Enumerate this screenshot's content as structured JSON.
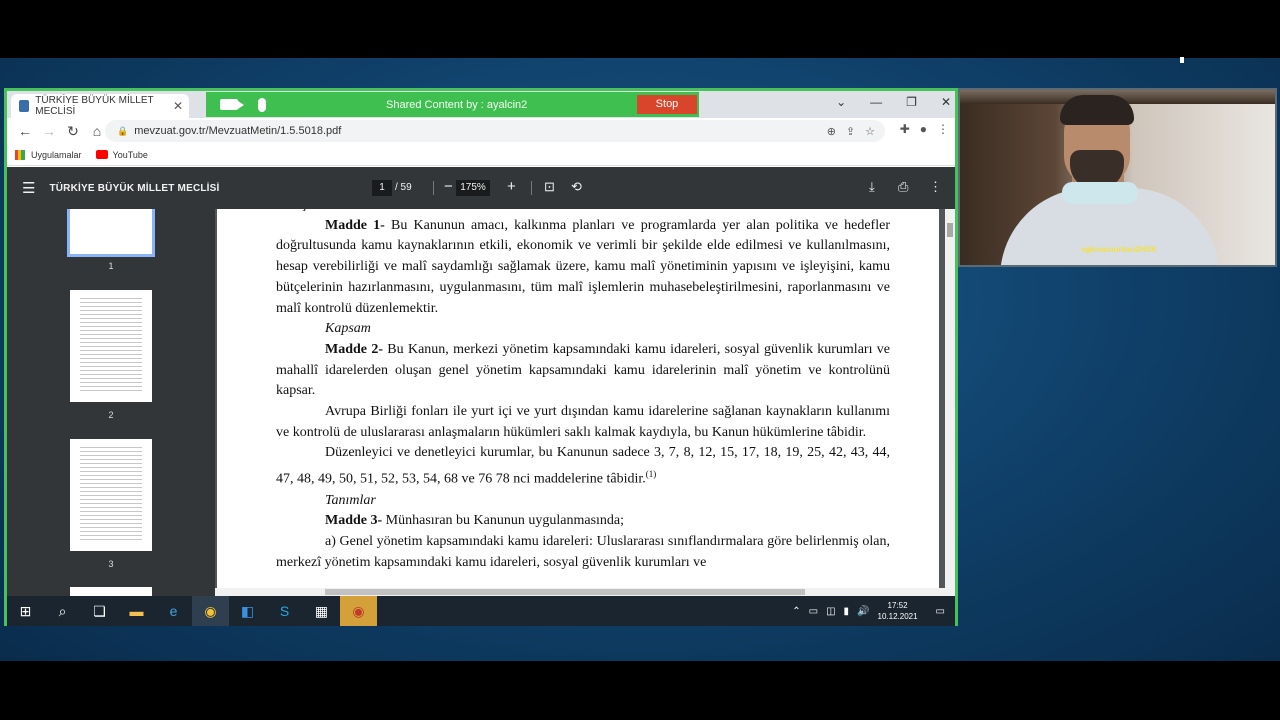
{
  "browser": {
    "tab_title": "TÜRKİYE BÜYÜK MİLLET MECLİSİ",
    "url": "mevzuat.gov.tr/MevzuatMetin/1.5.5018.pdf",
    "bookmarks": [
      "Uygulamalar",
      "YouTube"
    ]
  },
  "share_banner": {
    "text": "Shared Content by :  ayalcin2",
    "stop_label": "Stop"
  },
  "pdf_viewer": {
    "title": "TÜRKİYE BÜYÜK MİLLET MECLİSİ",
    "current_page": "1",
    "total_pages": "/ 59",
    "zoom": "175%",
    "thumbnails": [
      "1",
      "2",
      "3"
    ]
  },
  "document": {
    "lines": [
      {
        "style": "plain",
        "parts": [
          {
            "t": "Amaç",
            "s": "ital"
          }
        ]
      },
      {
        "style": "ind",
        "parts": [
          {
            "t": "Madde 1-",
            "s": "bold"
          },
          {
            "t": " Bu Kanunun amacı, kalkınma planları ve programlarda yer alan politika ve hedefler doğrultusunda kamu kaynaklarının etkili, ekonomik ve verimli bir şekilde elde edilmesi ve kullanılmasını, hesap verebilirliği ve malî saydamlığı sağlamak üzere, kamu malî yönetiminin yapısını ve işleyişini, kamu bütçelerinin hazırlanmasını, uygulanmasını, tüm malî işlemlerin muhasebeleştirilmesini, raporlanmasını ve malî kontrolü düzenlemektir.",
            "s": ""
          }
        ]
      },
      {
        "style": "ind",
        "parts": [
          {
            "t": "Kapsam",
            "s": "ital"
          }
        ]
      },
      {
        "style": "ind",
        "parts": [
          {
            "t": "Madde 2-",
            "s": "bold"
          },
          {
            "t": " Bu Kanun, merkezi yönetim kapsamındaki kamu idareleri, sosyal güvenlik kurumları ve mahallî idarelerden oluşan genel yönetim kapsamındaki kamu idarelerinin malî yönetim ve kontrolünü kapsar.",
            "s": ""
          }
        ]
      },
      {
        "style": "ind",
        "parts": [
          {
            "t": "Avrupa Birliği fonları ile yurt içi ve yurt dışından kamu idarelerine sağlanan kaynakların kullanımı ve kontrolü de uluslararası anlaşmaların hükümleri saklı kalmak kaydıyla, bu Kanun hükümlerine tâbidir.",
            "s": ""
          }
        ]
      },
      {
        "style": "ind",
        "parts": [
          {
            "t": "Düzenleyici ve denetleyici kurumlar, bu Kanunun sadece 3, 7, 8, 12, 15, 17, 18, 19, 25, 42, 43, 44, 47, 48, 49, 50, 51, 52, 53, 54, 68 ve 76 78 nci maddelerine tâbidir.",
            "s": ""
          },
          {
            "t": "(1)",
            "s": "sup"
          }
        ]
      },
      {
        "style": "ind",
        "parts": [
          {
            "t": "Tanımlar",
            "s": "ital"
          }
        ]
      },
      {
        "style": "ind",
        "parts": [
          {
            "t": "Madde 3-",
            "s": "bold"
          },
          {
            "t": " Münhasıran bu Kanunun uygulanmasında;",
            "s": ""
          }
        ]
      },
      {
        "style": "ind",
        "parts": [
          {
            "t": "a) Genel yönetim kapsamındaki kamu idareleri: Uluslararası sınıflandırmalara göre belirlenmiş olan, merkezî yönetim kapsamındaki kamu idareleri, sosyal güvenlik kurumları ve",
            "s": ""
          }
        ]
      }
    ]
  },
  "taskbar": {
    "time": "17:52",
    "date": "10.12.2021"
  },
  "webcam": {
    "label": "sgkmamurhan2HSK"
  }
}
